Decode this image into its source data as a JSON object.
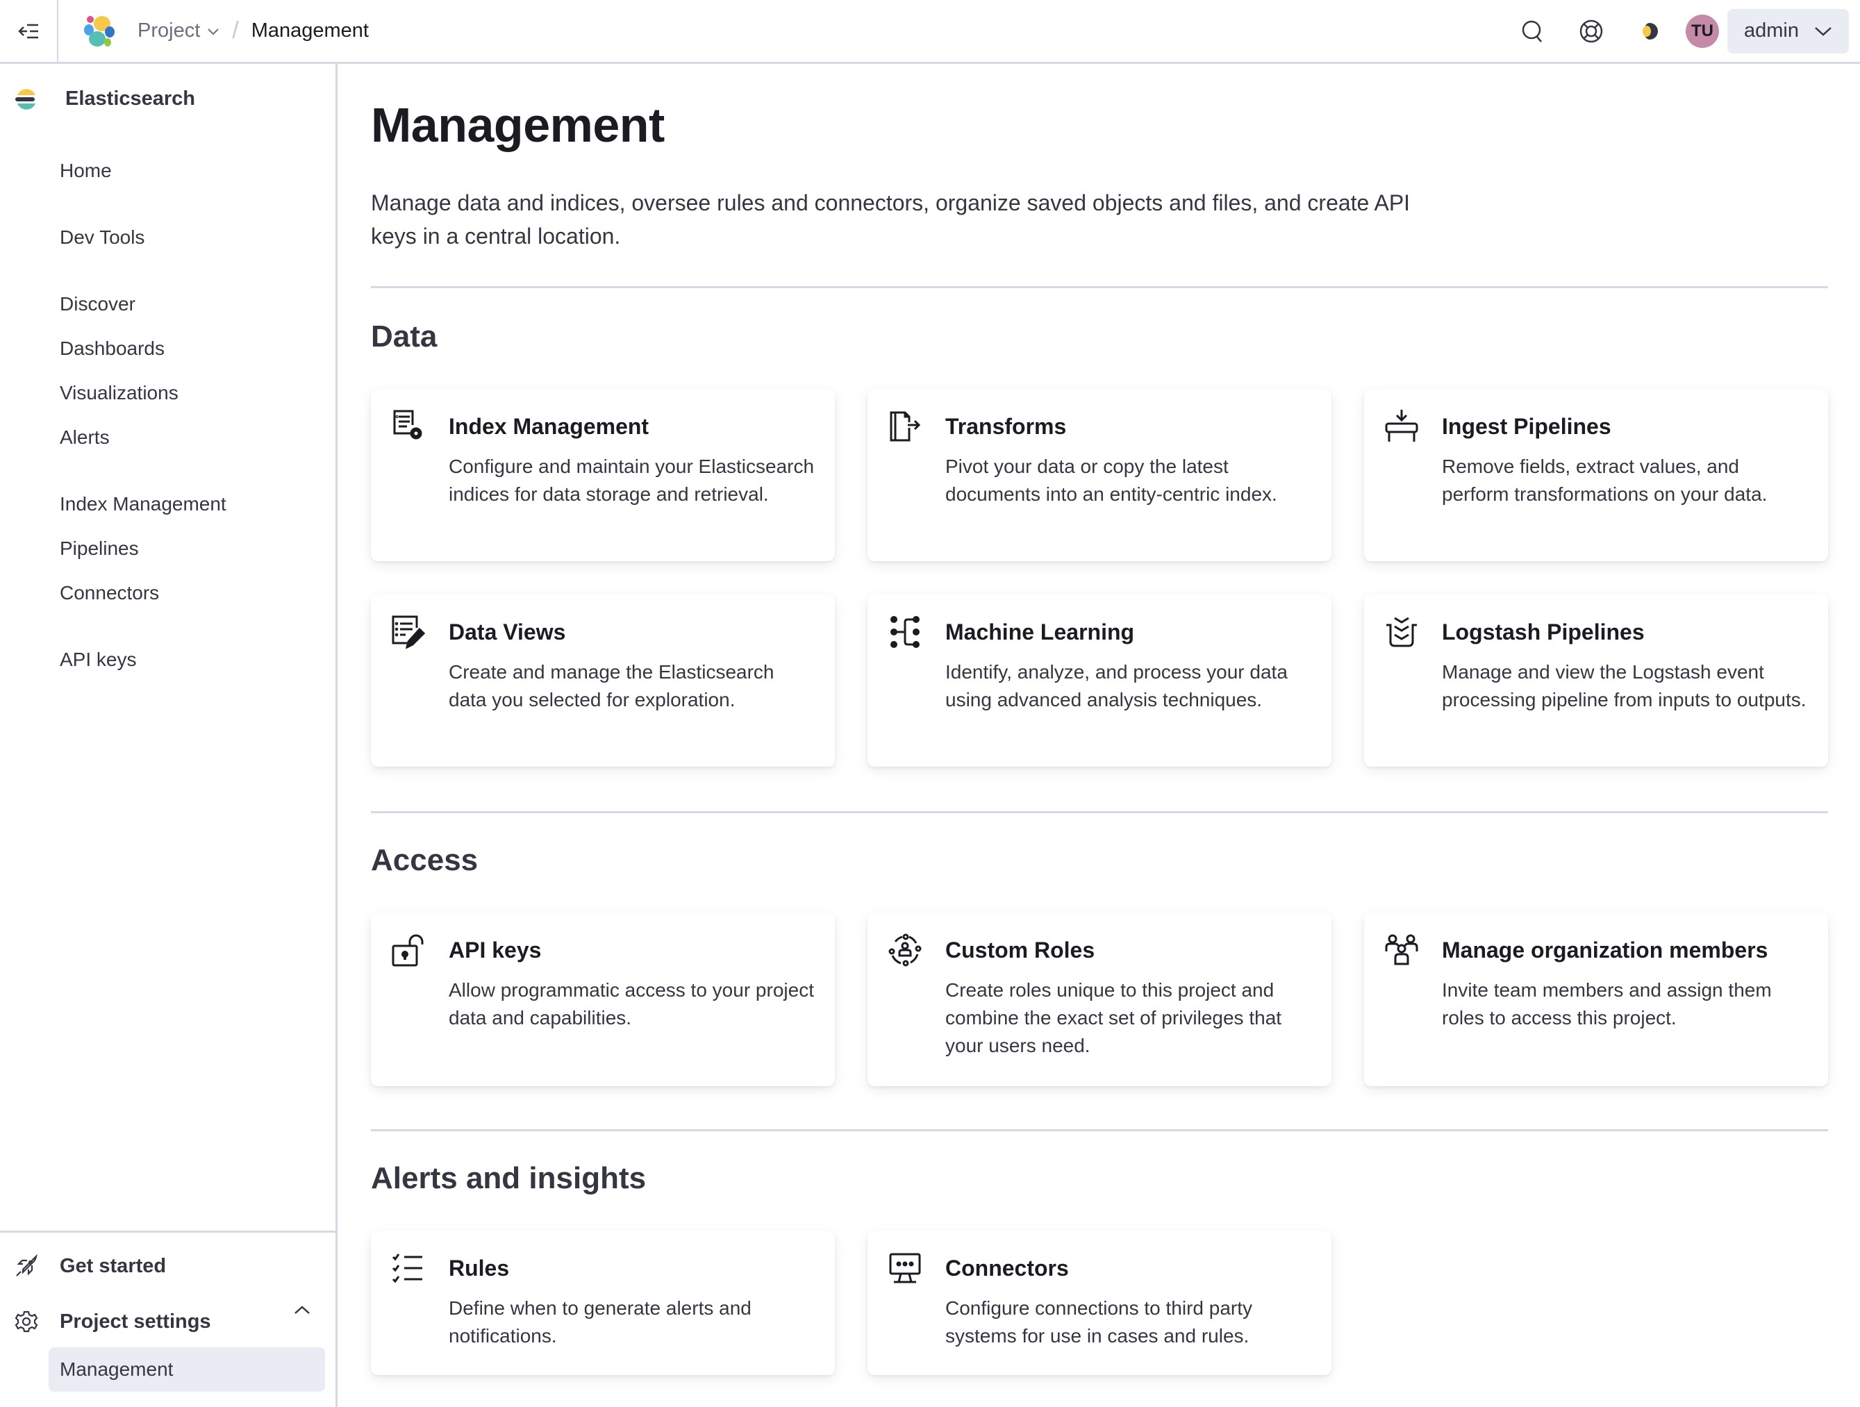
{
  "header": {
    "breadcrumb": {
      "project": "Project",
      "current": "Management"
    },
    "user_initials": "TU",
    "user_menu_label": "admin",
    "icons": [
      "collapse-nav-icon",
      "elastic-logo",
      "search-icon",
      "help-icon",
      "theme-icon"
    ],
    "avatar_color": "#c48aa8"
  },
  "sidebar": {
    "brand": "Elasticsearch",
    "items": [
      {
        "label": "Home"
      },
      {
        "label": "Dev Tools"
      },
      {
        "label": "Discover"
      },
      {
        "label": "Dashboards"
      },
      {
        "label": "Visualizations"
      },
      {
        "label": "Alerts"
      },
      {
        "label": "Index Management"
      },
      {
        "label": "Pipelines"
      },
      {
        "label": "Connectors"
      },
      {
        "label": "API keys"
      }
    ],
    "footer": {
      "get_started": "Get started",
      "project_settings": "Project settings",
      "active_item": "Management"
    }
  },
  "main": {
    "title": "Management",
    "description": "Manage data and indices, oversee rules and connectors, organize saved objects and files, and create API keys in a central location.",
    "sections": [
      {
        "title": "Data",
        "cards": [
          {
            "title": "Index Management",
            "description": "Configure and maintain your Elasticsearch indices for data storage and retrieval.",
            "icon": "index-management-icon"
          },
          {
            "title": "Transforms",
            "description": "Pivot your data or copy the latest documents into an entity-centric index.",
            "icon": "transforms-icon"
          },
          {
            "title": "Ingest Pipelines",
            "description": "Remove fields, extract values, and perform transformations on your data.",
            "icon": "ingest-pipelines-icon"
          },
          {
            "title": "Data Views",
            "description": "Create and manage the Elasticsearch data you selected for exploration.",
            "icon": "data-views-icon"
          },
          {
            "title": "Machine Learning",
            "description": "Identify, analyze, and process your data using advanced analysis techniques.",
            "icon": "machine-learning-icon"
          },
          {
            "title": "Logstash Pipelines",
            "description": "Manage and view the Logstash event processing pipeline from inputs to outputs.",
            "icon": "logstash-pipelines-icon"
          }
        ]
      },
      {
        "title": "Access",
        "cards": [
          {
            "title": "API keys",
            "description": "Allow programmatic access to your project data and capabilities.",
            "icon": "unlock-icon"
          },
          {
            "title": "Custom Roles",
            "description": "Create roles unique to this project and combine the exact set of privileges that your users need.",
            "icon": "custom-roles-icon"
          },
          {
            "title": "Manage organization members",
            "description": "Invite team members and assign them roles to access this project.",
            "icon": "users-icon"
          }
        ]
      },
      {
        "title": "Alerts and insights",
        "cards": [
          {
            "title": "Rules",
            "description": "Define when to generate alerts and notifications.",
            "icon": "rules-checklist-icon"
          },
          {
            "title": "Connectors",
            "description": "Configure connections to third party systems for use in cases and rules.",
            "icon": "connectors-monitor-icon"
          }
        ]
      }
    ]
  }
}
